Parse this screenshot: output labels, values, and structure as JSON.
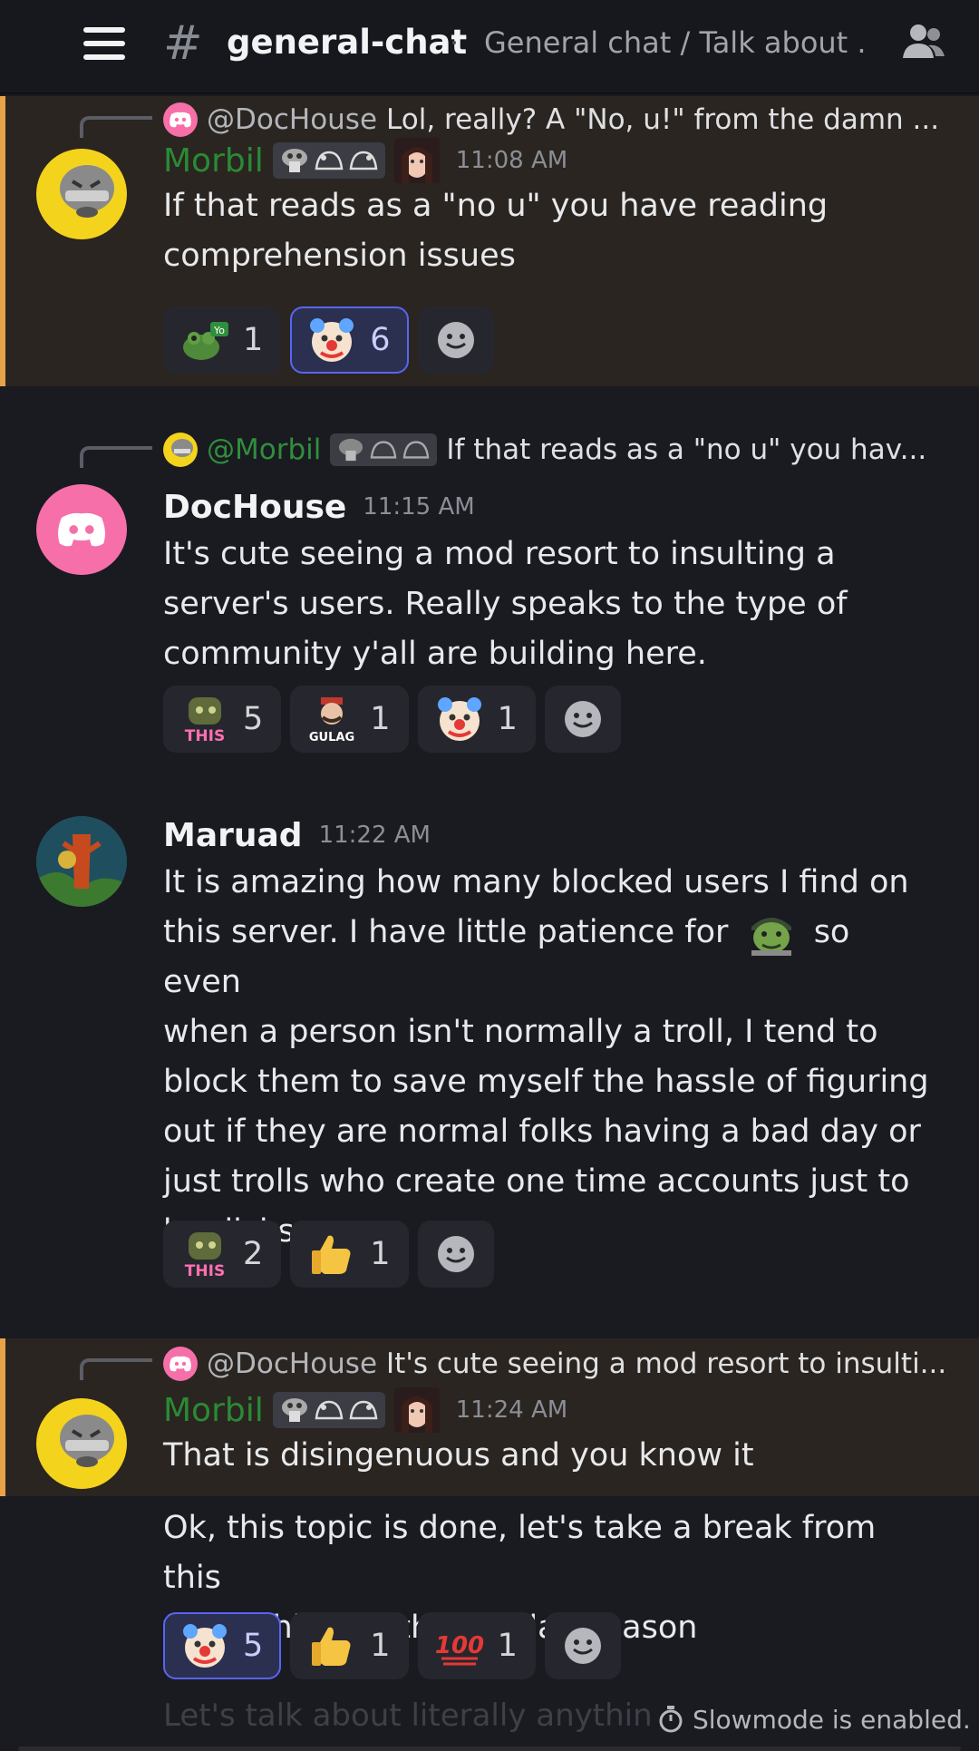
{
  "header": {
    "menu_icon": "hamburger-menu-icon",
    "channel_hash": "#",
    "channel_name": "general-chat",
    "topic": "General chat / Talk about ...",
    "members_icon": "members-icon"
  },
  "messages": [
    {
      "reply": {
        "name": "@DocHouse",
        "text": "Lol, really? A \"No, u!\" from the damn ..."
      },
      "author": "Morbil",
      "time": "11:08 AM",
      "lines": [
        "If that reads as a \"no u\" you have reading",
        "comprehension issues"
      ],
      "reactions": [
        {
          "emoji": "frog-yo-emoji",
          "count": "1",
          "active": false
        },
        {
          "emoji": "clown-emoji",
          "count": "6",
          "active": true
        }
      ]
    },
    {
      "reply": {
        "name": "@Morbil",
        "text": "If that reads as a \"no u\" you hav..."
      },
      "author": "DocHouse",
      "time": "11:15 AM",
      "lines": [
        "It's cute seeing a mod resort to insulting a",
        "server's users. Really speaks to the type of",
        "community y'all are building here."
      ],
      "reactions": [
        {
          "emoji": "this-emoji",
          "count": "5",
          "active": false
        },
        {
          "emoji": "gulag-emoji",
          "count": "1",
          "active": false
        },
        {
          "emoji": "clown-emoji",
          "count": "1",
          "active": false
        }
      ]
    },
    {
      "author": "Maruad",
      "time": "11:22 AM",
      "line1_a": "It is amazing how many blocked users I find on",
      "line2_a": "this server. I have little patience for",
      "line2_b": "so even",
      "lines": [
        "when a person isn't normally a troll, I tend to",
        "block them to save myself the hassle of figuring",
        "out if they are normal folks having a bad day or",
        "just trolls who create one time accounts just to",
        "be dicks."
      ],
      "reactions": [
        {
          "emoji": "this-emoji",
          "count": "2",
          "active": false
        },
        {
          "emoji": "thumbs-up-emoji",
          "count": "1",
          "active": false
        }
      ]
    },
    {
      "reply": {
        "name": "@DocHouse",
        "text": "It's cute seeing a mod resort to insulti..."
      },
      "author": "Morbil",
      "time": "11:24 AM",
      "lines": [
        "That is disingenuous and you know it"
      ],
      "followup": [
        "Ok, this topic is done, let's take a break from this",
        "for a while. Its the holiday season"
      ],
      "reactions": [
        {
          "emoji": "clown-emoji",
          "count": "5",
          "active": true
        },
        {
          "emoji": "thumbs-up-emoji",
          "count": "1",
          "active": false
        },
        {
          "emoji": "hundred-emoji",
          "count": "1",
          "active": false
        }
      ]
    }
  ],
  "footer": {
    "faded_text": "Let's talk about literally anythin",
    "slowmode": "Slowmode is enabled.",
    "slowmode_icon": "stopwatch-icon"
  },
  "colors": {
    "highlight_bar": "#e8a24a",
    "active_reaction": "#5865f2",
    "mod_name": "#2a8a35",
    "discord_pink": "#f66fa9"
  }
}
